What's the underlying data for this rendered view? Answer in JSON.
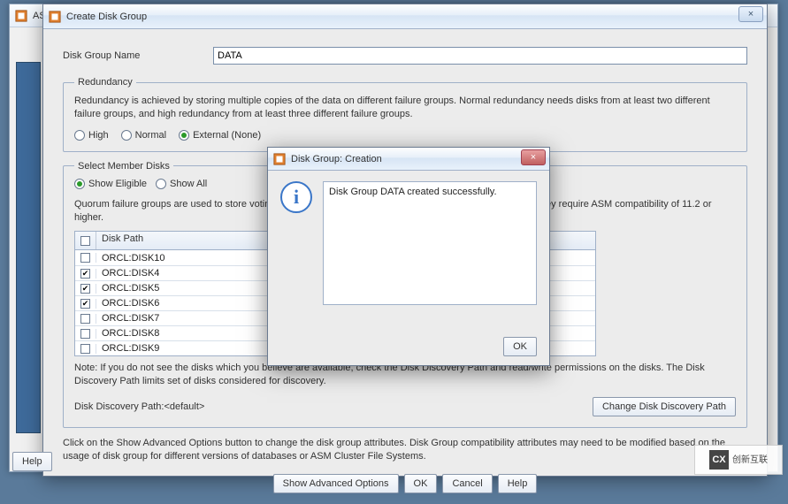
{
  "bg_window": {
    "title": "AS"
  },
  "window": {
    "title": "Create Disk Group",
    "close_label": "×"
  },
  "name_field": {
    "label": "Disk Group Name",
    "value": "DATA"
  },
  "redundancy": {
    "legend": "Redundancy",
    "description": "Redundancy is achieved by storing multiple copies of the data on different failure groups. Normal redundancy needs disks from at least two different failure groups, and high redundancy from at least three different failure groups.",
    "options": [
      {
        "label": "High",
        "selected": false
      },
      {
        "label": "Normal",
        "selected": false
      },
      {
        "label": "External (None)",
        "selected": true
      }
    ]
  },
  "member_disks": {
    "legend": "Select Member Disks",
    "filter": [
      {
        "label": "Show Eligible",
        "selected": true
      },
      {
        "label": "Show All",
        "selected": false
      }
    ],
    "quorum_text": "Quorum failure groups are used to store voting files in extended clusters and do not contain any user data. They require ASM compatibility of 11.2 or higher.",
    "header": {
      "path": "Disk Path"
    },
    "rows": [
      {
        "checked": false,
        "path": "ORCL:DISK10"
      },
      {
        "checked": true,
        "path": "ORCL:DISK4"
      },
      {
        "checked": true,
        "path": "ORCL:DISK5"
      },
      {
        "checked": true,
        "path": "ORCL:DISK6"
      },
      {
        "checked": false,
        "path": "ORCL:DISK7"
      },
      {
        "checked": false,
        "path": "ORCL:DISK8"
      },
      {
        "checked": false,
        "path": "ORCL:DISK9"
      }
    ],
    "note": "Note: If you do not see the disks which you believe are available, check the Disk Discovery Path and read/write permissions on the disks. The Disk Discovery Path limits set of disks considered for discovery.",
    "discovery_label": "Disk Discovery Path:<default>",
    "change_path_btn": "Change Disk Discovery Path"
  },
  "instruction": "Click on the Show Advanced Options button to change the disk group attributes. Disk Group compatibility attributes may need to be modified based on the usage of disk group for different versions of databases or ASM Cluster File Systems.",
  "footer": {
    "advanced": "Show Advanced Options",
    "ok": "OK",
    "cancel": "Cancel",
    "help": "Help"
  },
  "outer_help": "Help",
  "modal": {
    "title": "Disk Group: Creation",
    "message": "Disk Group DATA created successfully.",
    "ok": "OK",
    "close": "×"
  },
  "watermark": {
    "badge": "CX",
    "text": "创新互联"
  }
}
